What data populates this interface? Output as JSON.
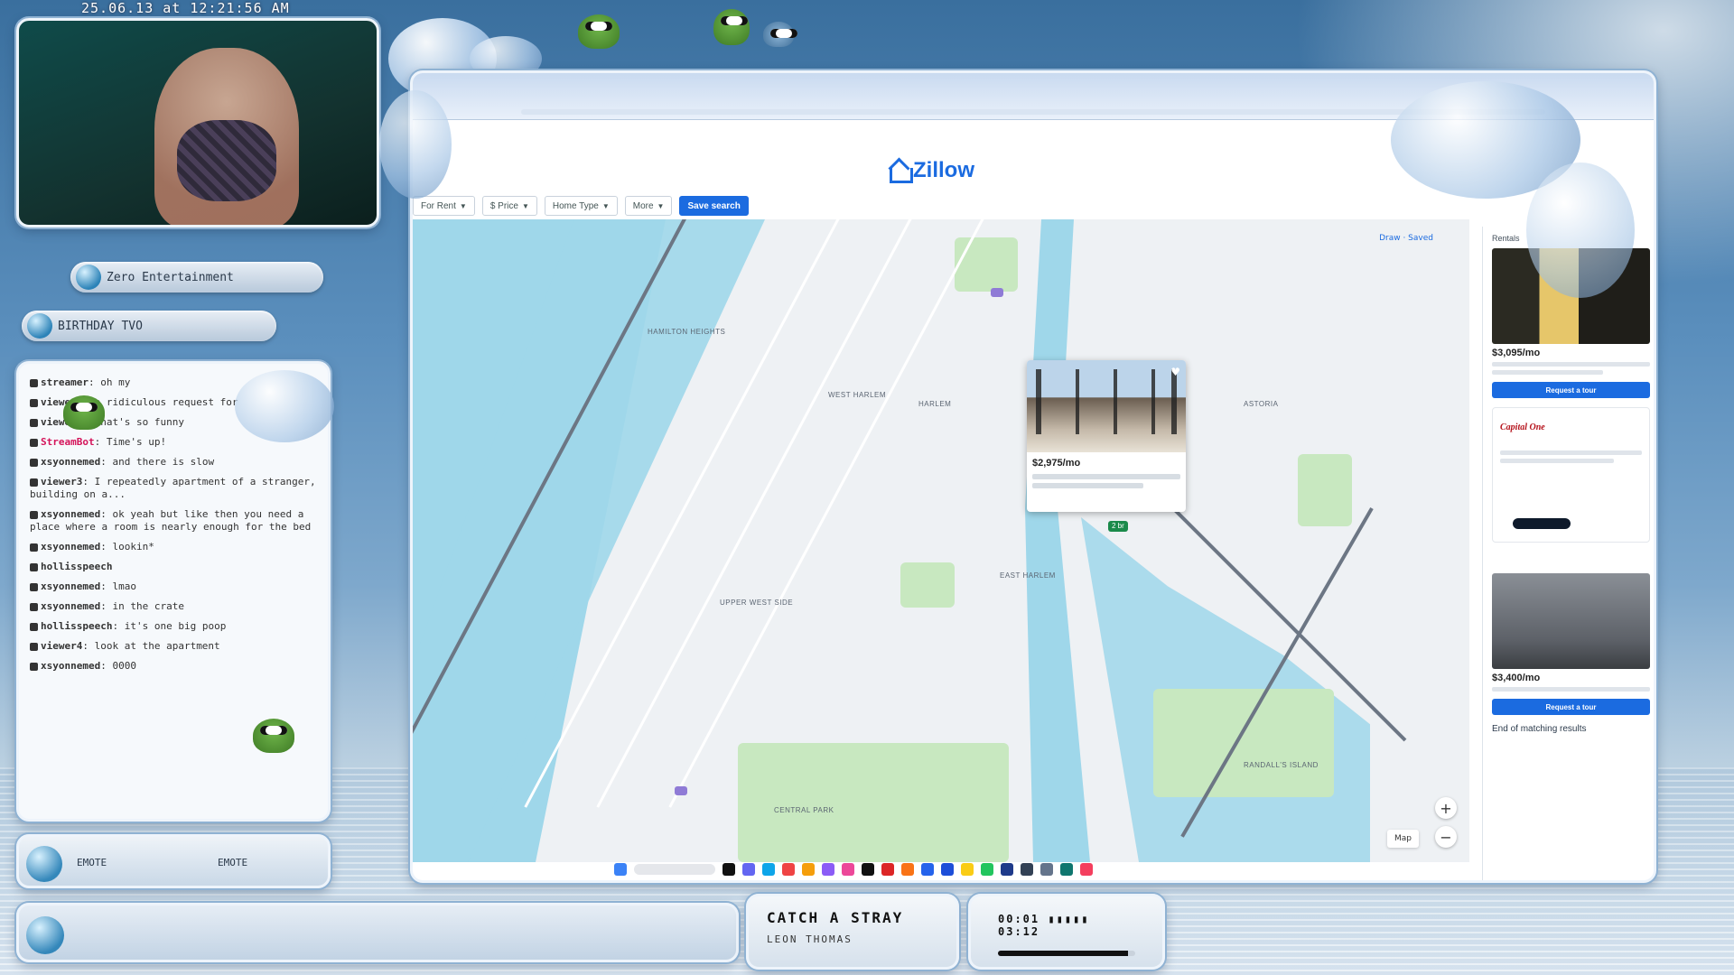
{
  "overlay": {
    "timestamp": "25.06.13 at 12:21:56 AM",
    "streamer_title": "Zero Entertainment",
    "follower_line": "BIRTHDAY TVO"
  },
  "chat": {
    "messages": [
      {
        "user": "streamer",
        "text": "oh my"
      },
      {
        "user": "viewer1",
        "text": "a ridiculous request for"
      },
      {
        "user": "viewer2",
        "text": "that's so funny"
      },
      {
        "user": "StreamBot",
        "text": "Time's up!"
      },
      {
        "user": "xsyonnemed",
        "text": "and there is slow"
      },
      {
        "user": "viewer3",
        "text": "I repeatedly apartment of a stranger, building on a..."
      },
      {
        "user": "xsyonnemed",
        "text": "ok yeah but like then you need a place where a room is nearly enough for the bed"
      },
      {
        "user": "xsyonnemed",
        "text": "lookin*"
      },
      {
        "user": "hollisspeech",
        "text": ""
      },
      {
        "user": "xsyonnemed",
        "text": "lmao"
      },
      {
        "user": "xsyonnemed",
        "text": "in the crate"
      },
      {
        "user": "hollisspeech",
        "text": "it's one big poop"
      },
      {
        "user": "viewer4",
        "text": "look at the apartment"
      },
      {
        "user": "xsyonnemed",
        "text": "0000"
      }
    ]
  },
  "zillow": {
    "logo": "Zillow",
    "filters": [
      {
        "label": "For Rent"
      },
      {
        "label": "$ Price"
      },
      {
        "label": "Home Type"
      },
      {
        "label": "More"
      }
    ],
    "save_search": "Save search",
    "map": {
      "top_links": "Draw  ·  Saved",
      "map_type": "Map",
      "labels": [
        "WEST HARLEM",
        "HARLEM",
        "EAST HARLEM",
        "UPPER WEST SIDE",
        "RANDALL'S ISLAND",
        "ASTORIA",
        "CENTRAL PARK",
        "HAMILTON HEIGHTS"
      ],
      "marker_label": "2 br"
    },
    "popup": {
      "price": "$2,975/mo",
      "heart": "♥"
    },
    "listings": {
      "header": "Rentals",
      "card1_price": "$3,095/mo",
      "card1_button": "Request a tour",
      "ad_brand": "Capital One",
      "card2_price": "$3,400/mo",
      "card2_button": "Request a tour",
      "end": "End of matching results"
    }
  },
  "media": {
    "track": "CATCH A STRAY",
    "artist": "LEON THOMAS",
    "elapsed": "00:01",
    "duration": "03:12",
    "progress": 0.95
  },
  "emote_bar": {
    "left": "EMOTE",
    "right": "EMOTE"
  },
  "colors": {
    "accent": "#1b6be0",
    "water": "#9fd7ea",
    "park": "#c8e8c0"
  }
}
